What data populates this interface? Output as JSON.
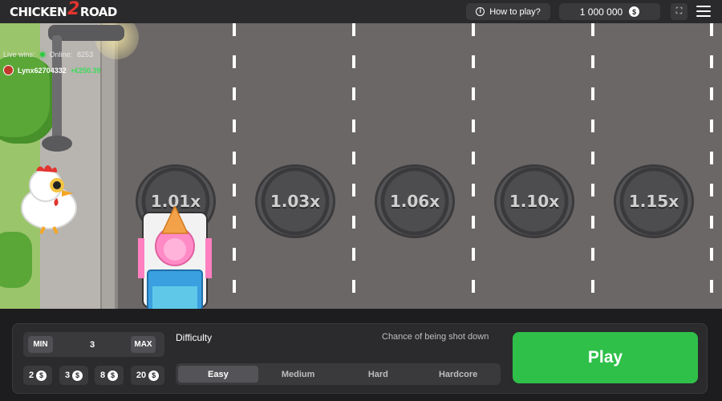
{
  "header": {
    "logo_left": "CHICKEN",
    "logo_number": "2",
    "logo_right": "ROAD",
    "how_to_play": "How to play?",
    "balance": "1 000 000",
    "currency_symbol": "$"
  },
  "live": {
    "label": "Live wins:",
    "online_label": "Online:",
    "online_count": "8253",
    "recent_win": {
      "user": "Lynx62704332",
      "amount": "+€250.39"
    }
  },
  "lanes": {
    "multipliers": [
      "1.01x",
      "1.03x",
      "1.06x",
      "1.10x",
      "1.15x"
    ]
  },
  "controls": {
    "min_label": "MIN",
    "max_label": "MAX",
    "bet_value": "3",
    "quick_bets": [
      "2",
      "3",
      "8",
      "20"
    ],
    "difficulty_label": "Difficulty",
    "chance_label": "Chance of being shot down",
    "difficulties": [
      "Easy",
      "Medium",
      "Hard",
      "Hardcore"
    ],
    "selected_difficulty": "Easy",
    "play_label": "Play"
  },
  "colors": {
    "accent_green": "#2fc04a",
    "win_green": "#3ddc5a",
    "logo_red": "#e3342f",
    "road": "#6b6766"
  },
  "icons": [
    "info-icon",
    "coin-icon",
    "fullscreen-icon",
    "menu-icon",
    "avatar"
  ]
}
